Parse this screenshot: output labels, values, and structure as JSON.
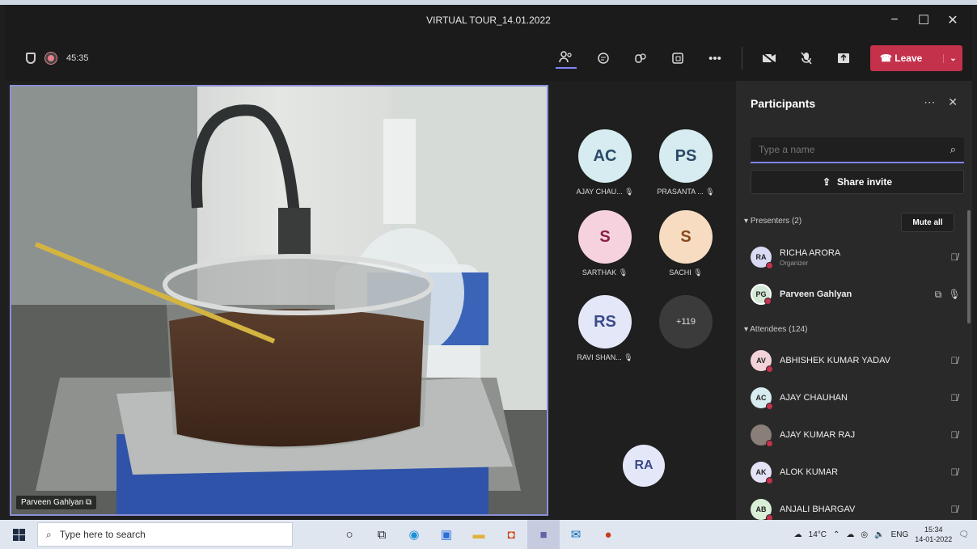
{
  "window": {
    "title": "VIRTUAL TOUR_14.01.2022",
    "controls": [
      "−",
      "☐",
      "✕"
    ]
  },
  "toolbar": {
    "timer": "45:35",
    "leave_label": "Leave"
  },
  "video": {
    "presenter_name": "Parveen Gahlyan"
  },
  "grid": {
    "tiles": [
      {
        "initials": "AC",
        "name": "AJAY CHAU...",
        "bg": "#d6ecf0",
        "fg": "#2a4a66"
      },
      {
        "initials": "PS",
        "name": "PRASANTA ...",
        "bg": "#d6ecf0",
        "fg": "#2a4a66"
      },
      {
        "initials": "S",
        "name": "SARTHAK",
        "bg": "#f5d2dd",
        "fg": "#8a2042"
      },
      {
        "initials": "S",
        "name": "SACHI",
        "bg": "#f7dcc2",
        "fg": "#8a4a1a"
      },
      {
        "initials": "RS",
        "name": "RAVI SHAN...",
        "bg": "#e4e7f7",
        "fg": "#3b4a8a"
      },
      {
        "initials": "+119",
        "name": "",
        "bg": "#3b3b3b",
        "fg": "#dddddd"
      }
    ],
    "bottom_tile": {
      "initials": "RA"
    }
  },
  "panel": {
    "title": "Participants",
    "search_placeholder": "Type a name",
    "share_label": "Share invite",
    "presenters_label": "Presenters (2)",
    "mute_all_label": "Mute all",
    "presenters": [
      {
        "initials": "RA",
        "name": "RICHA ARORA",
        "sub": "Organizer",
        "bg": "#d9dbf5"
      },
      {
        "initials": "PG",
        "name": "Parveen Gahlyan",
        "sub": "",
        "bg": "#d3e9d6"
      }
    ],
    "attendees_label": "Attendees (124)",
    "attendees": [
      {
        "initials": "AV",
        "name": "ABHISHEK KUMAR YADAV",
        "bg": "#f2d4d8"
      },
      {
        "initials": "AC",
        "name": "AJAY CHAUHAN",
        "bg": "#d6ecf0"
      },
      {
        "initials": "",
        "name": "AJAY KUMAR RAJ",
        "bg": "#8a7f78"
      },
      {
        "initials": "AK",
        "name": "ALOK KUMAR",
        "bg": "#e4e2f5"
      },
      {
        "initials": "AB",
        "name": "ANJALI BHARGAV",
        "bg": "#d9eed6"
      }
    ]
  },
  "taskbar": {
    "search_placeholder": "Type here to search",
    "temperature": "14°C",
    "lang": "ENG",
    "time": "15:34",
    "date": "14-01-2022"
  }
}
